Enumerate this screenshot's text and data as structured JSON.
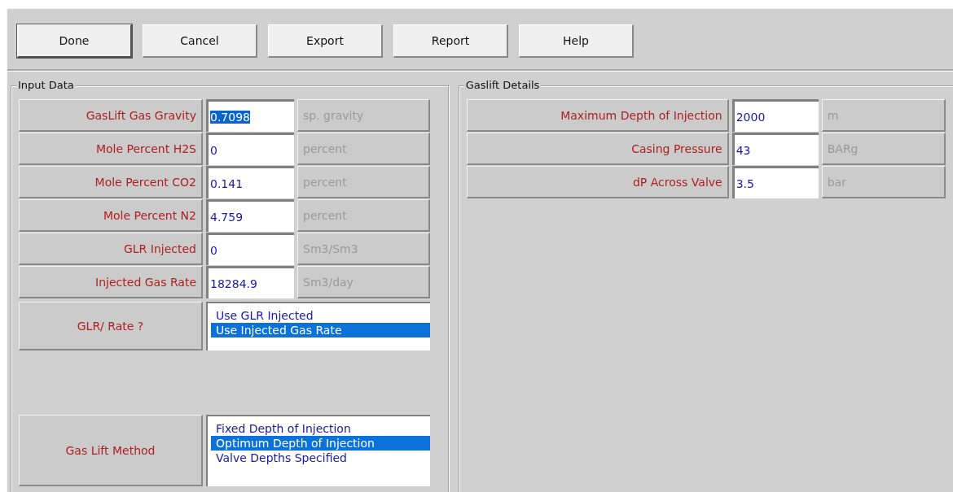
{
  "toolbar": {
    "buttons": [
      {
        "label": "Done",
        "default": true
      },
      {
        "label": "Cancel",
        "default": false
      },
      {
        "label": "Export",
        "default": false
      },
      {
        "label": "Report",
        "default": false
      },
      {
        "label": "Help",
        "default": false
      }
    ]
  },
  "input_data": {
    "title": "Input Data",
    "fields": [
      {
        "label": "GasLift Gas Gravity",
        "value": "0.7098",
        "unit": "sp. gravity",
        "text_selected": true
      },
      {
        "label": "Mole Percent H2S",
        "value": "0",
        "unit": "percent",
        "text_selected": false
      },
      {
        "label": "Mole Percent CO2",
        "value": "0.141",
        "unit": "percent",
        "text_selected": false
      },
      {
        "label": "Mole Percent N2",
        "value": "4.759",
        "unit": "percent",
        "text_selected": false
      },
      {
        "label": "GLR Injected",
        "value": "0",
        "unit": "Sm3/Sm3",
        "text_selected": false
      },
      {
        "label": "Injected Gas Rate",
        "value": "18284.9",
        "unit": "Sm3/day",
        "text_selected": false
      }
    ],
    "choices": [
      {
        "label": "GLR/ Rate ?",
        "options": [
          {
            "label": "Use GLR Injected",
            "selected": false
          },
          {
            "label": "Use Injected Gas Rate",
            "selected": true
          }
        ]
      },
      {
        "label": "Gas Lift Method",
        "options": [
          {
            "label": "Fixed Depth of Injection",
            "selected": false
          },
          {
            "label": "Optimum Depth of Injection",
            "selected": true
          },
          {
            "label": "Valve Depths Specified",
            "selected": false
          }
        ]
      }
    ]
  },
  "gaslift_details": {
    "title": "Gaslift Details",
    "fields": [
      {
        "label": "Maximum Depth of Injection",
        "value": "2000",
        "unit": "m",
        "text_selected": false
      },
      {
        "label": "Casing Pressure",
        "value": "43",
        "unit": "BARg",
        "text_selected": false
      },
      {
        "label": "dP Across Valve",
        "value": "3.5",
        "unit": "bar",
        "text_selected": false
      }
    ]
  }
}
